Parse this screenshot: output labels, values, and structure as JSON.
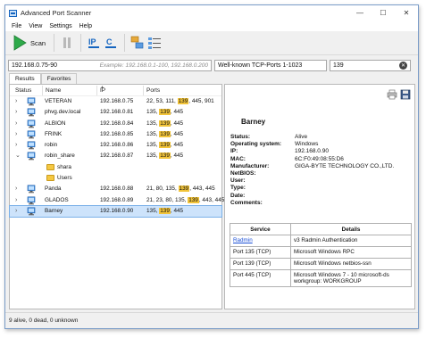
{
  "window": {
    "title": "Advanced Port Scanner"
  },
  "menu": [
    "File",
    "View",
    "Settings",
    "Help"
  ],
  "toolbar": {
    "scan_label": "Scan"
  },
  "inputs": {
    "range_value": "192.168.0.75-90",
    "range_example": "Example: 192.168.0.1-100, 192.168.0.200",
    "ports_value": "Well-known TCP-Ports 1-1023",
    "search_value": "139"
  },
  "tabs": [
    "Results",
    "Favorites"
  ],
  "columns": {
    "status": "Status",
    "name": "Name",
    "ip": "IP",
    "ports": "Ports"
  },
  "rows": [
    {
      "name": "VETERAN",
      "ip": "192.168.0.75",
      "ports_pre": "22, 53, 111, ",
      "ports_hl": "139",
      "ports_post": ", 445, 901",
      "expander": "›"
    },
    {
      "name": "phvg.dev.local",
      "ip": "192.168.0.81",
      "ports_pre": "135, ",
      "ports_hl": "139",
      "ports_post": ", 445",
      "expander": "›"
    },
    {
      "name": "ALBION",
      "ip": "192.168.0.84",
      "ports_pre": "135, ",
      "ports_hl": "139",
      "ports_post": ", 445",
      "expander": "›"
    },
    {
      "name": "FRINK",
      "ip": "192.168.0.85",
      "ports_pre": "135, ",
      "ports_hl": "139",
      "ports_post": ", 445",
      "expander": "›"
    },
    {
      "name": "robin",
      "ip": "192.168.0.86",
      "ports_pre": "135, ",
      "ports_hl": "139",
      "ports_post": ", 445",
      "expander": "›"
    },
    {
      "name": "robin_share",
      "ip": "192.168.0.87",
      "ports_pre": "135, ",
      "ports_hl": "139",
      "ports_post": ", 445",
      "expander": "⌄"
    },
    {
      "folder": "shara"
    },
    {
      "folder": "Users"
    },
    {
      "name": "Panda",
      "ip": "192.168.0.88",
      "ports_pre": "21, 80, 135, ",
      "ports_hl": "139",
      "ports_post": ", 443, 445",
      "expander": "›"
    },
    {
      "name": "GLADOS",
      "ip": "192.168.0.89",
      "ports_pre": "21, 23, 80, 135, ",
      "ports_hl": "139",
      "ports_post": ", 443, 445",
      "expander": "›"
    },
    {
      "name": "Barney",
      "ip": "192.168.0.90",
      "ports_pre": "135, ",
      "ports_hl": "139",
      "ports_post": ", 445",
      "expander": "›",
      "selected": true
    }
  ],
  "details": {
    "name": "Barney",
    "props": [
      {
        "label": "Status:",
        "value": "Alive"
      },
      {
        "label": "Operating system:",
        "value": "Windows"
      },
      {
        "label": "IP:",
        "value": "192.168.0.90"
      },
      {
        "label": "MAC:",
        "value": "6C:F0:49:08:55:D6"
      },
      {
        "label": "Manufacturer:",
        "value": "GIGA-BYTE TECHNOLOGY CO.,LTD."
      },
      {
        "label": "NetBIOS:",
        "value": ""
      },
      {
        "label": "User:",
        "value": ""
      },
      {
        "label": "Type:",
        "value": ""
      },
      {
        "label": "Date:",
        "value": ""
      },
      {
        "label": "Comments:",
        "value": ""
      }
    ],
    "services_header": {
      "service": "Service",
      "details": "Details"
    },
    "services": [
      {
        "service": "Radmin",
        "is_link": true,
        "details": "v3 Radmin Authentication"
      },
      {
        "service": "Port 135 (TCP)",
        "details": "Microsoft Windows RPC"
      },
      {
        "service": "Port 139 (TCP)",
        "details": "Microsoft Windows netbios-ssn"
      },
      {
        "service": "Port 445 (TCP)",
        "details": "Microsoft Windows 7 - 10 microsoft-ds workgroup: WORKGROUP"
      }
    ]
  },
  "statusbar": {
    "text": "9 alive, 0 dead, 0 unknown"
  },
  "colors": {
    "accent": "#1565c0",
    "highlight": "#f2c43a",
    "selection": "#cde3fb",
    "link": "#1a4fd6",
    "scan_green": "#2eaa4a"
  },
  "icons": [
    "app-icon",
    "minimize-icon",
    "maximize-icon",
    "close-icon",
    "play-icon",
    "pause-icon",
    "ip-icon",
    "c-icon",
    "network-icon",
    "list-icon",
    "print-icon",
    "save-icon",
    "computer-icon",
    "folder-icon"
  ]
}
